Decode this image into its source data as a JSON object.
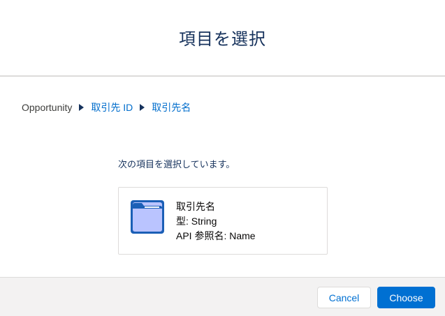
{
  "modal": {
    "title": "項目を選択"
  },
  "breadcrumb": {
    "root": "Opportunity",
    "items": [
      "取引先 ID",
      "取引先名"
    ]
  },
  "selection": {
    "intro": "次の項目を選択しています。",
    "field_label": "取引先名",
    "type_line": "型: String",
    "api_line": "API 参照名: Name",
    "icon": "folder-icon"
  },
  "footer": {
    "cancel_label": "Cancel",
    "choose_label": "Choose"
  },
  "colors": {
    "link": "#006dcc",
    "brand": "#0070d2",
    "title_text": "#16325c",
    "folder_fill": "#bac4ff",
    "folder_border": "#1b5fb6"
  }
}
